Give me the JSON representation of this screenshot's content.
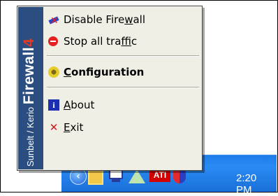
{
  "menu": {
    "sidebar_brand": [
      "Sunbelt / Kerio ",
      "Firewall",
      "4"
    ],
    "items": [
      {
        "label_pre": "Disable Fire",
        "label_u": "w",
        "label_post": "all",
        "icon": "firewall-disable-icon"
      },
      {
        "label_pre": "Stop all tra",
        "label_u": "f",
        "label_post": "fic",
        "icon": "stop-icon"
      },
      {
        "label_pre": "",
        "label_u": "C",
        "label_post": "onfiguration",
        "icon": "configuration-gear-icon"
      },
      {
        "label_pre": "",
        "label_u": "A",
        "label_post": "bout",
        "icon": "info-icon"
      },
      {
        "label_pre": "",
        "label_u": "E",
        "label_post": "xit",
        "icon": "exit-x-icon"
      }
    ]
  },
  "taskbar": {
    "tray_icons": [
      "expand-arrow-icon",
      "folder-icon",
      "network-icon",
      "triangle-icon",
      "ati-icon",
      "firewall-shield-icon"
    ],
    "ati_text": "ATI",
    "clock": "2:20 PM"
  },
  "colors": {
    "menu_bg": "#f0efe6",
    "sidebar_bg": "#2c4d80",
    "taskbar_blue": "#2a8bf4",
    "brand_accent": "#e03b28"
  }
}
